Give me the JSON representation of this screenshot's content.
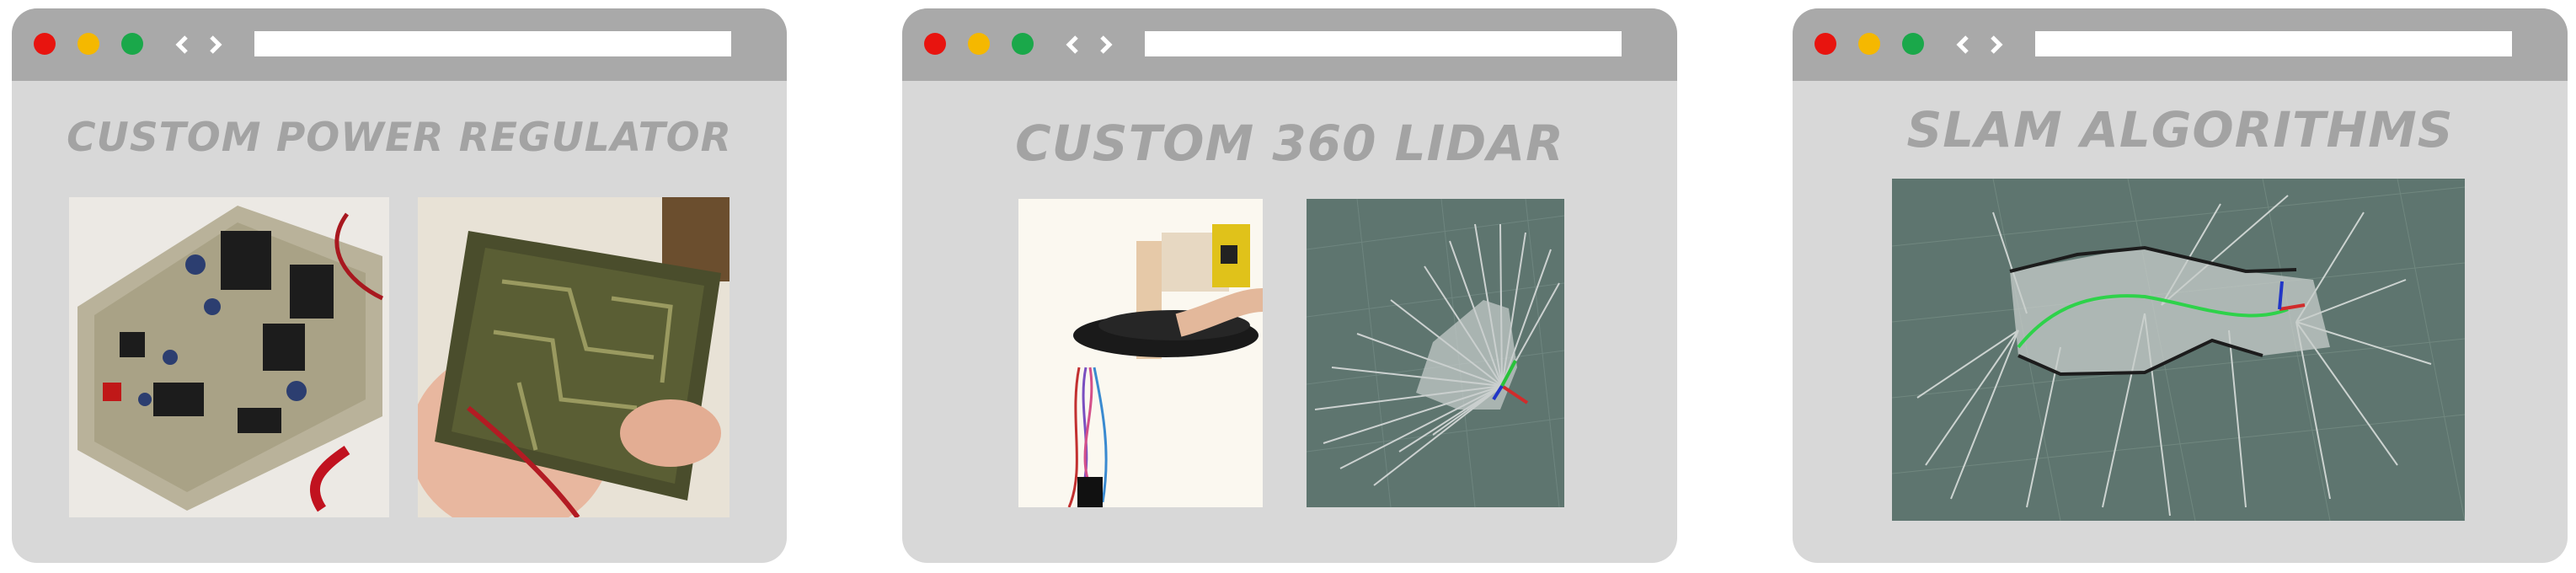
{
  "windows": [
    {
      "title": "CUSTOM POWER REGULATOR",
      "images": [
        "power-regulator-board-photo",
        "pcb-underside-photo"
      ]
    },
    {
      "title": "CUSTOM 360 LIDAR",
      "images": [
        "lidar-hardware-photo",
        "lidar-scan-visualization"
      ]
    },
    {
      "title": "SLAM ALGORITHMS",
      "images": [
        "slam-map-visualization"
      ]
    }
  ],
  "colors": {
    "window_bg": "#d8d8d8",
    "titlebar": "#a9a9a9",
    "title_text": "#a3a3a3",
    "close": "#e8140f",
    "minimize": "#f5b800",
    "maximize": "#1aa84a",
    "viz_bg": "#5e756f"
  },
  "icons": [
    "close-dot",
    "minimize-dot",
    "maximize-dot",
    "chevron-left-icon",
    "chevron-right-icon"
  ]
}
